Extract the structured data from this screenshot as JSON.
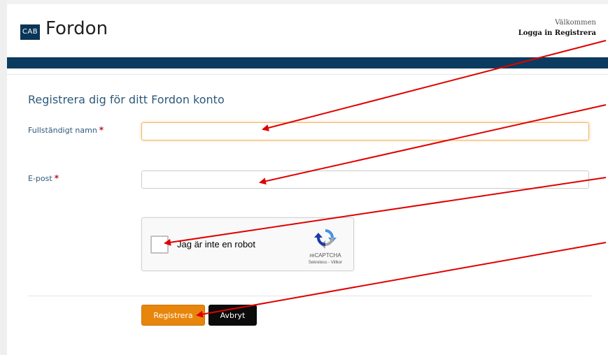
{
  "header": {
    "logo_text": "CAB",
    "app_title": "Fordon",
    "welcome": "Välkommen",
    "login_label": "Logga in",
    "register_label": "Registrera"
  },
  "form": {
    "heading": "Registrera dig för ditt Fordon konto",
    "full_name_label": "Fullständigt namn",
    "full_name_value": "",
    "email_label": "E-post",
    "email_value": "",
    "required_marker": "*"
  },
  "captcha": {
    "label": "Jag är inte en robot",
    "brand": "reCAPTCHA",
    "terms": "Sekretess - Villkor"
  },
  "buttons": {
    "submit": "Registrera",
    "cancel": "Avbryt"
  },
  "colors": {
    "brand_dark": "#0b3b5e",
    "heading_blue": "#2e5a7a",
    "primary_button": "#e8860c",
    "secondary_button": "#0b0b0b",
    "required": "#c0151b",
    "annotation_arrow": "#e00000"
  }
}
